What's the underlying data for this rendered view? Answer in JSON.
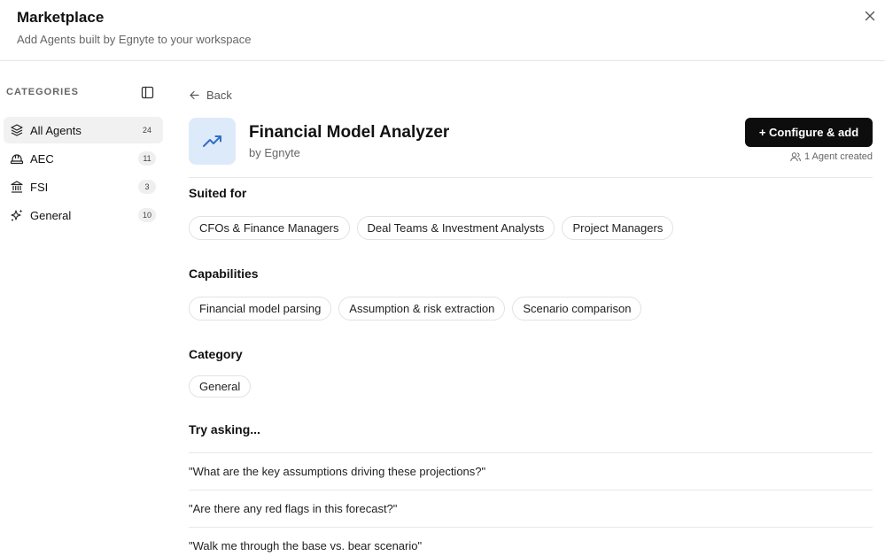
{
  "header": {
    "title": "Marketplace",
    "subtitle": "Add Agents built by Egnyte to your workspace"
  },
  "sidebar": {
    "heading": "CATEGORIES",
    "items": [
      {
        "label": "All Agents",
        "count": "24",
        "icon": "layers-icon"
      },
      {
        "label": "AEC",
        "count": "11",
        "icon": "hard-hat-icon"
      },
      {
        "label": "FSI",
        "count": "3",
        "icon": "bank-icon"
      },
      {
        "label": "General",
        "count": "10",
        "icon": "sparkles-icon"
      }
    ]
  },
  "main": {
    "back_label": "Back",
    "agent": {
      "title": "Financial Model Analyzer",
      "by": "by Egnyte",
      "icon": "trending-up-icon"
    },
    "configure_label": "+ Configure & add",
    "agents_created": "1 Agent created",
    "suited_for": {
      "title": "Suited for",
      "items": [
        "CFOs & Finance Managers",
        "Deal Teams & Investment Analysts",
        "Project Managers"
      ]
    },
    "capabilities": {
      "title": "Capabilities",
      "items": [
        "Financial model parsing",
        "Assumption & risk extraction",
        "Scenario comparison"
      ]
    },
    "category": {
      "title": "Category",
      "items": [
        "General"
      ]
    },
    "try_asking": {
      "title": "Try asking...",
      "prompts": [
        "\"What are the key assumptions driving these projections?\"",
        "\"Are there any red flags in this forecast?\"",
        "\"Walk me through the base vs. bear scenario\""
      ]
    }
  },
  "colors": {
    "accent_icon_bg": "#ddeaf9",
    "accent_icon": "#2f6fc9",
    "primary_button": "#0d0d0d"
  }
}
